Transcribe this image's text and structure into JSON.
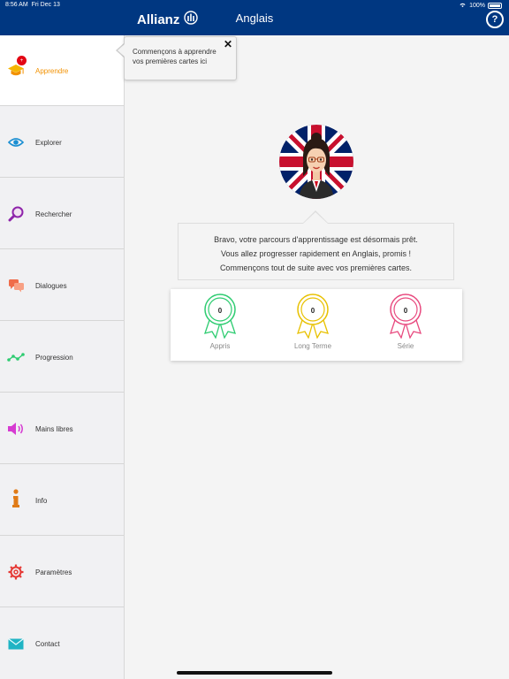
{
  "status_bar": {
    "time": "8:56 AM",
    "date": "Fri Dec 13",
    "battery": "100%"
  },
  "header": {
    "brand": "Allianz",
    "title": "Anglais",
    "help_icon": "help-icon"
  },
  "colors": {
    "header_bg": "#003781",
    "accent": "#f29100",
    "badge": "#e30613"
  },
  "sidebar": {
    "items": [
      {
        "label": "Apprendre",
        "icon": "graduation-cap-icon",
        "badge": "+"
      },
      {
        "label": "Explorer",
        "icon": "eye-icon"
      },
      {
        "label": "Rechercher",
        "icon": "magnifier-icon"
      },
      {
        "label": "Dialogues",
        "icon": "chat-bubbles-icon"
      },
      {
        "label": "Progression",
        "icon": "progress-line-icon"
      },
      {
        "label": "Mains libres",
        "icon": "speaker-icon"
      },
      {
        "label": "Info",
        "icon": "info-icon"
      },
      {
        "label": "Paramètres",
        "icon": "gear-icon"
      },
      {
        "label": "Contact",
        "icon": "envelope-icon"
      }
    ]
  },
  "tooltip": {
    "text": "Commençons à apprendre vos premières cartes ici",
    "close": "✕"
  },
  "message": {
    "line1": "Bravo, votre parcours d'apprentissage est désormais prêt.",
    "line2": "Vous allez progresser rapidement en Anglais, promis !",
    "line3": "Commençons tout de suite avec vos premières cartes."
  },
  "stats": [
    {
      "label": "Appris",
      "value": "0",
      "color": "#2ecc71"
    },
    {
      "label": "Long Terme",
      "value": "0",
      "color": "#f1c40f"
    },
    {
      "label": "Série",
      "value": "0",
      "color": "#e84a7f"
    }
  ]
}
